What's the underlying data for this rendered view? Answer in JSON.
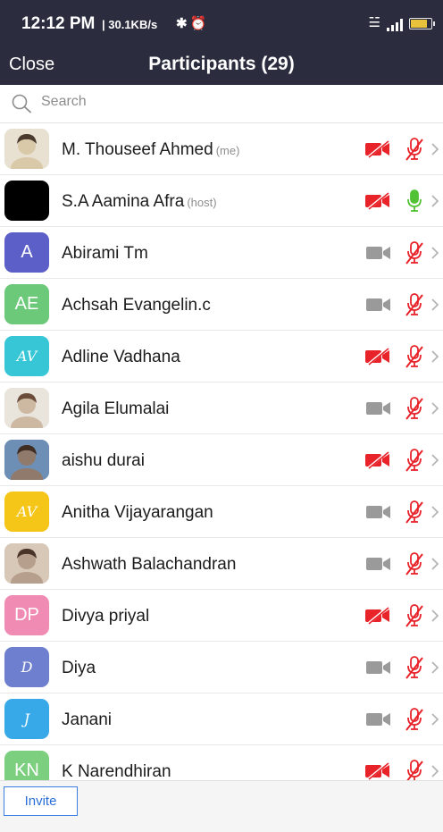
{
  "status_bar": {
    "time": "12:12 PM",
    "speed": "| 30.1KB/s",
    "icons": [
      "snooze-icon",
      "alarm-icon",
      "wifi-icon",
      "signal-icon",
      "battery-icon"
    ]
  },
  "nav": {
    "close_label": "Close",
    "title": "Participants (29)"
  },
  "search": {
    "placeholder": "Search"
  },
  "participants": [
    {
      "name": "M. Thouseef Ahmed",
      "tag": "(me)",
      "video_on": false,
      "audio_on": false,
      "avatar": {
        "type": "photo",
        "colors": [
          "#d9c9a8",
          "#4a3a2e",
          "#e8e1d2"
        ]
      }
    },
    {
      "name": "S.A Aamina Afra",
      "tag": "(host)",
      "video_on": false,
      "audio_on": true,
      "avatar": {
        "type": "solid",
        "color": "#000000"
      }
    },
    {
      "name": "Abirami Tm",
      "tag": "",
      "video_on": true,
      "audio_on": false,
      "avatar": {
        "type": "initials",
        "text": "A",
        "color": "#5b5fc7"
      }
    },
    {
      "name": "Achsah Evangelin.c",
      "tag": "",
      "video_on": true,
      "audio_on": false,
      "avatar": {
        "type": "initials",
        "text": "AE",
        "color": "#6cc97a"
      }
    },
    {
      "name": "Adline Vadhana",
      "tag": "",
      "video_on": false,
      "audio_on": false,
      "avatar": {
        "type": "script",
        "text": "AV",
        "color": "#36c6d6"
      }
    },
    {
      "name": "Agila Elumalai",
      "tag": "",
      "video_on": true,
      "audio_on": false,
      "avatar": {
        "type": "photo",
        "colors": [
          "#cdb9a2",
          "#6b4c3a",
          "#e9e4dc"
        ]
      }
    },
    {
      "name": "aishu durai",
      "tag": "",
      "video_on": false,
      "audio_on": false,
      "avatar": {
        "type": "photo",
        "colors": [
          "#8f7a6b",
          "#3f2d24",
          "#6e8fb5"
        ]
      }
    },
    {
      "name": "Anitha Vijayarangan",
      "tag": "",
      "video_on": true,
      "audio_on": false,
      "avatar": {
        "type": "script",
        "text": "AV",
        "color": "#f5c518"
      }
    },
    {
      "name": "Ashwath Balachandran",
      "tag": "",
      "video_on": true,
      "audio_on": false,
      "avatar": {
        "type": "photo",
        "colors": [
          "#b79f8d",
          "#4a342a",
          "#d8c8b8"
        ]
      }
    },
    {
      "name": "Divya priyal",
      "tag": "",
      "video_on": false,
      "audio_on": false,
      "avatar": {
        "type": "initials",
        "text": "DP",
        "color": "#f08bb3"
      }
    },
    {
      "name": "Diya",
      "tag": "",
      "video_on": true,
      "audio_on": false,
      "avatar": {
        "type": "script",
        "text": "D",
        "color": "#6f7fcf"
      }
    },
    {
      "name": "Janani",
      "tag": "",
      "video_on": true,
      "audio_on": false,
      "avatar": {
        "type": "script",
        "text": "J",
        "color": "#37a9e8"
      }
    },
    {
      "name": "K Narendhiran",
      "tag": "",
      "video_on": false,
      "audio_on": false,
      "avatar": {
        "type": "initials",
        "text": "KN",
        "color": "#7ccf7e"
      }
    }
  ],
  "footer": {
    "invite_label": "Invite"
  },
  "colors": {
    "header_bg": "#2b2d3e",
    "muted_red": "#e8232a",
    "unmuted_green": "#52c234",
    "camera_grey": "#9a9a9a",
    "link_blue": "#2b6fd6"
  }
}
